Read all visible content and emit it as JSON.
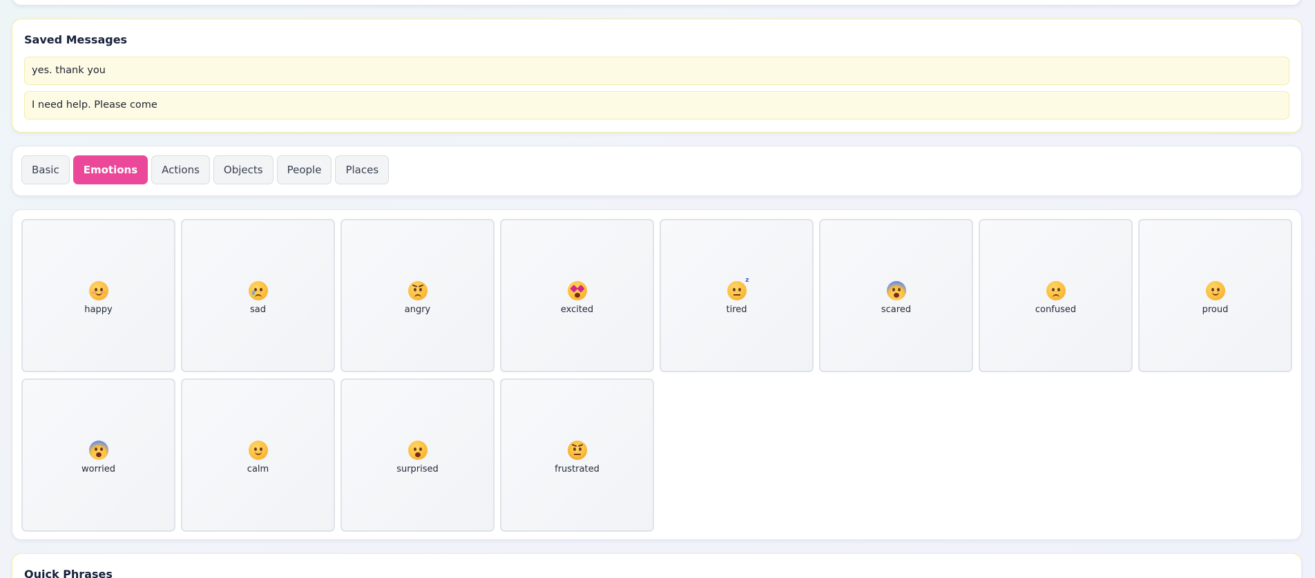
{
  "saved_messages": {
    "title": "Saved Messages",
    "items": [
      "yes. thank you",
      "I need help. Please come"
    ]
  },
  "tabs": [
    {
      "label": "Basic",
      "active": false
    },
    {
      "label": "Emotions",
      "active": true
    },
    {
      "label": "Actions",
      "active": false
    },
    {
      "label": "Objects",
      "active": false
    },
    {
      "label": "People",
      "active": false
    },
    {
      "label": "Places",
      "active": false
    }
  ],
  "accent_color": "#ec4899",
  "emotions": [
    {
      "label": "happy",
      "icon": "smiling-face-icon"
    },
    {
      "label": "sad",
      "icon": "crying-face-icon"
    },
    {
      "label": "angry",
      "icon": "angry-face-icon"
    },
    {
      "label": "excited",
      "icon": "star-struck-face-icon"
    },
    {
      "label": "tired",
      "icon": "sleeping-face-icon"
    },
    {
      "label": "scared",
      "icon": "screaming-face-icon"
    },
    {
      "label": "confused",
      "icon": "confused-face-icon"
    },
    {
      "label": "proud",
      "icon": "relieved-face-icon"
    },
    {
      "label": "worried",
      "icon": "fearful-face-icon"
    },
    {
      "label": "calm",
      "icon": "calm-face-icon"
    },
    {
      "label": "surprised",
      "icon": "astonished-face-icon"
    },
    {
      "label": "frustrated",
      "icon": "steaming-face-icon"
    }
  ],
  "quick_phrases": {
    "title": "Quick Phrases"
  }
}
